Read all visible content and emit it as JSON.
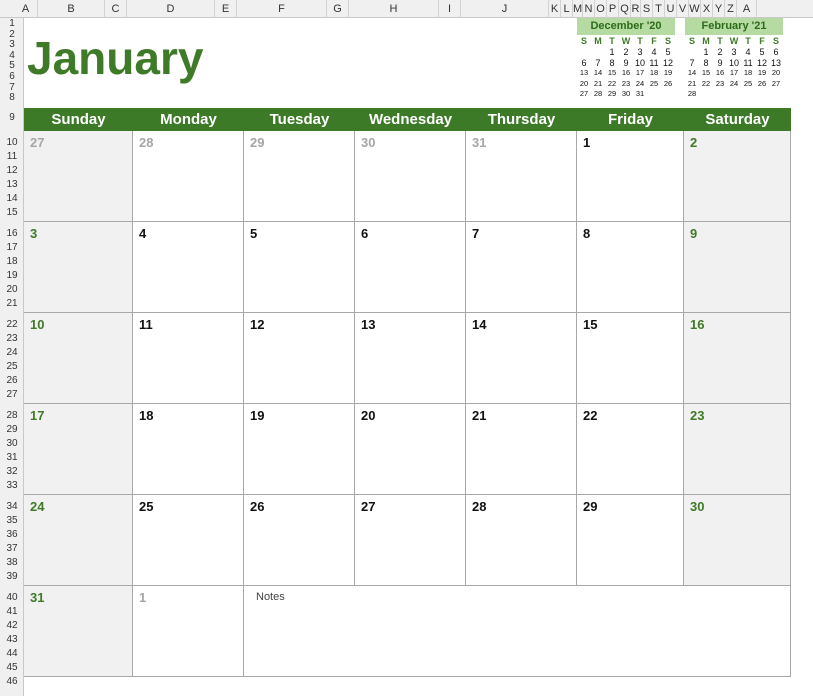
{
  "spreadsheet": {
    "columns": [
      "A",
      "B",
      "C",
      "D",
      "E",
      "F",
      "G",
      "H",
      "I",
      "J",
      "K",
      "L",
      "M",
      "N",
      "O",
      "P",
      "Q",
      "R",
      "S",
      "T",
      "U",
      "V",
      "W",
      "X",
      "Y",
      "Z",
      "A"
    ],
    "rows": [
      "1",
      "2",
      "3",
      "4",
      "5",
      "6",
      "7",
      "8",
      "9",
      "10",
      "11",
      "12",
      "13",
      "14",
      "15",
      "16",
      "17",
      "18",
      "19",
      "20",
      "21",
      "22",
      "23",
      "24",
      "25",
      "26",
      "27",
      "28",
      "29",
      "30",
      "31",
      "32",
      "33",
      "34",
      "35",
      "36",
      "37",
      "38",
      "39",
      "40",
      "41",
      "42",
      "43",
      "44",
      "45",
      "46"
    ]
  },
  "calendar": {
    "month_title": "January",
    "weekdays": [
      "Sunday",
      "Monday",
      "Tuesday",
      "Wednesday",
      "Thursday",
      "Friday",
      "Saturday"
    ],
    "weeks": [
      [
        {
          "day": "27",
          "style": "grey"
        },
        {
          "day": "28",
          "style": "grey"
        },
        {
          "day": "29",
          "style": "grey"
        },
        {
          "day": "30",
          "style": "grey"
        },
        {
          "day": "31",
          "style": "grey"
        },
        {
          "day": "1",
          "style": "black"
        },
        {
          "day": "2",
          "style": "green"
        }
      ],
      [
        {
          "day": "3",
          "style": "green"
        },
        {
          "day": "4",
          "style": "black"
        },
        {
          "day": "5",
          "style": "black"
        },
        {
          "day": "6",
          "style": "black"
        },
        {
          "day": "7",
          "style": "black"
        },
        {
          "day": "8",
          "style": "black"
        },
        {
          "day": "9",
          "style": "green"
        }
      ],
      [
        {
          "day": "10",
          "style": "green"
        },
        {
          "day": "11",
          "style": "black"
        },
        {
          "day": "12",
          "style": "black"
        },
        {
          "day": "13",
          "style": "black"
        },
        {
          "day": "14",
          "style": "black"
        },
        {
          "day": "15",
          "style": "black"
        },
        {
          "day": "16",
          "style": "green"
        }
      ],
      [
        {
          "day": "17",
          "style": "green"
        },
        {
          "day": "18",
          "style": "black"
        },
        {
          "day": "19",
          "style": "black"
        },
        {
          "day": "20",
          "style": "black"
        },
        {
          "day": "21",
          "style": "black"
        },
        {
          "day": "22",
          "style": "black"
        },
        {
          "day": "23",
          "style": "green"
        }
      ],
      [
        {
          "day": "24",
          "style": "green"
        },
        {
          "day": "25",
          "style": "black"
        },
        {
          "day": "26",
          "style": "black"
        },
        {
          "day": "27",
          "style": "black"
        },
        {
          "day": "28",
          "style": "black"
        },
        {
          "day": "29",
          "style": "black"
        },
        {
          "day": "30",
          "style": "green"
        }
      ],
      [
        {
          "day": "31",
          "style": "green"
        },
        {
          "day": "1",
          "style": "grey"
        }
      ]
    ],
    "notes_label": "Notes"
  },
  "mini_calendars": [
    {
      "title": "December '20",
      "dow": [
        "S",
        "M",
        "T",
        "W",
        "T",
        "F",
        "S"
      ],
      "weeks": [
        [
          "",
          "",
          "1",
          "2",
          "3",
          "4",
          "5"
        ],
        [
          "6",
          "7",
          "8",
          "9",
          "10",
          "11",
          "12"
        ],
        [
          "13",
          "14",
          "15",
          "16",
          "17",
          "18",
          "19"
        ],
        [
          "20",
          "21",
          "22",
          "23",
          "24",
          "25",
          "26"
        ],
        [
          "27",
          "28",
          "29",
          "30",
          "31",
          "",
          ""
        ]
      ]
    },
    {
      "title": "February '21",
      "dow": [
        "S",
        "M",
        "T",
        "W",
        "T",
        "F",
        "S"
      ],
      "weeks": [
        [
          "",
          "1",
          "2",
          "3",
          "4",
          "5",
          "6"
        ],
        [
          "7",
          "8",
          "9",
          "10",
          "11",
          "12",
          "13"
        ],
        [
          "14",
          "15",
          "16",
          "17",
          "18",
          "19",
          "20"
        ],
        [
          "21",
          "22",
          "23",
          "24",
          "25",
          "26",
          "27"
        ],
        [
          "28",
          "",
          "",
          "",
          "",
          "",
          ""
        ]
      ]
    }
  ],
  "colors": {
    "accent_green": "#3d7a27",
    "title_green": "#3f7a28",
    "mini_header_bg": "#b5dba2",
    "weekend_bg": "#f1f1f1",
    "past_day_grey": "#a6a6a6"
  }
}
